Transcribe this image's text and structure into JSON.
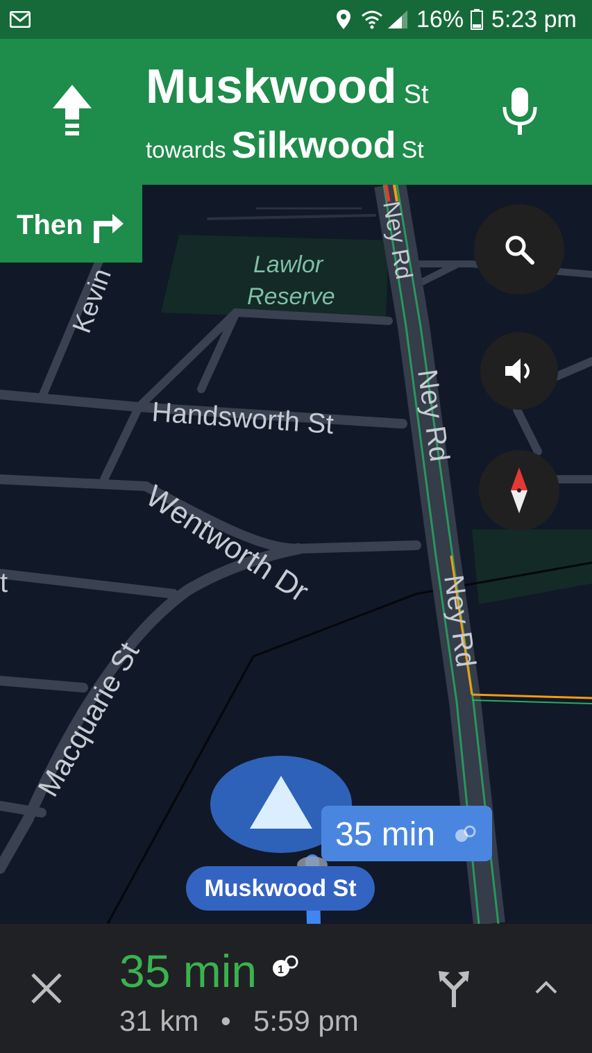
{
  "status_bar": {
    "battery": "16%",
    "time": "5:23 pm",
    "icons": [
      "gmail-icon",
      "location-icon",
      "wifi-icon",
      "signal-icon",
      "battery-icon"
    ]
  },
  "instruction": {
    "direction_icon": "straight-arrow-icon",
    "street": "Muskwood",
    "street_suffix": "St",
    "towards_word": "towards",
    "towards_street": "Silkwood",
    "towards_suffix": "St"
  },
  "next_step": {
    "label": "Then",
    "icon": "turn-right-icon"
  },
  "map": {
    "labels": {
      "lawlor": "Lawlor",
      "reserve": "Reserve",
      "kevin": "Kevin",
      "handsworth": "Handsworth St",
      "wentworth": "Wentworth Dr",
      "macquarie": "Macquarie St",
      "ney_rd": "Ney Rd",
      "edge_t": "t"
    },
    "eta_bubble": "35 min",
    "current_street": "Muskwood St"
  },
  "trip": {
    "duration": "35 min",
    "distance": "31 km",
    "separator": "•",
    "arrival": "5:59 pm"
  },
  "colors": {
    "header_green": "#1e8c4a",
    "statusbar_green": "#166a39",
    "map_bg": "#111827",
    "road": "#3a4150",
    "eta_green": "#3bb24e",
    "route_blue": "#4a86e0"
  }
}
